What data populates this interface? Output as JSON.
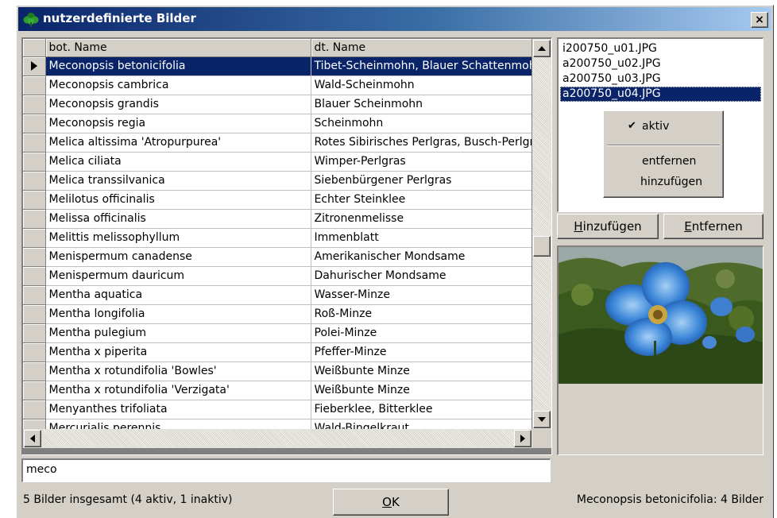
{
  "window": {
    "title": "nutzerdefinierte Bilder",
    "close_label": "×"
  },
  "grid": {
    "columns": [
      "bot. Name",
      "dt. Name"
    ],
    "selected_index": 0,
    "rows": [
      {
        "bot": "Meconopsis betonicifolia",
        "dt": "Tibet-Scheinmohn, Blauer Schattenmohn"
      },
      {
        "bot": "Meconopsis cambrica",
        "dt": "Wald-Scheinmohn"
      },
      {
        "bot": "Meconopsis grandis",
        "dt": "Blauer Scheinmohn"
      },
      {
        "bot": "Meconopsis regia",
        "dt": "Scheinmohn"
      },
      {
        "bot": "Melica altissima 'Atropurpurea'",
        "dt": "Rotes Sibirisches Perlgras, Busch-Perlgras"
      },
      {
        "bot": "Melica ciliata",
        "dt": "Wimper-Perlgras"
      },
      {
        "bot": "Melica transsilvanica",
        "dt": "Siebenbürgener Perlgras"
      },
      {
        "bot": "Melilotus officinalis",
        "dt": "Echter Steinklee"
      },
      {
        "bot": "Melissa officinalis",
        "dt": "Zitronenmelisse"
      },
      {
        "bot": "Melittis melissophyllum",
        "dt": "Immenblatt"
      },
      {
        "bot": "Menispermum canadense",
        "dt": "Amerikanischer Mondsame"
      },
      {
        "bot": "Menispermum dauricum",
        "dt": "Dahurischer Mondsame"
      },
      {
        "bot": "Mentha aquatica",
        "dt": "Wasser-Minze"
      },
      {
        "bot": "Mentha longifolia",
        "dt": "Roß-Minze"
      },
      {
        "bot": "Mentha pulegium",
        "dt": "Polei-Minze"
      },
      {
        "bot": "Mentha x piperita",
        "dt": "Pfeffer-Minze"
      },
      {
        "bot": "Mentha x rotundifolia 'Bowles'",
        "dt": "Weißbunte Minze"
      },
      {
        "bot": "Mentha x rotundifolia 'Verzigata'",
        "dt": "Weißbunte Minze"
      },
      {
        "bot": "Menyanthes trifoliata",
        "dt": "Fieberklee, Bitterklee"
      },
      {
        "bot": "Mercurialis perennis",
        "dt": "Wald-Bingelkraut"
      }
    ]
  },
  "files": {
    "items": [
      "i200750_u01.JPG",
      "a200750_u02.JPG",
      "a200750_u03.JPG",
      "a200750_u04.JPG"
    ],
    "selected_index": 3
  },
  "context_menu": {
    "aktiv": "aktiv",
    "entfernen": "entfernen",
    "hinzufuegen": "hinzufügen"
  },
  "buttons": {
    "add_accel": "H",
    "add_rest": "inzufügen",
    "remove_accel": "E",
    "remove_rest": "ntfernen",
    "ok_accel": "O",
    "ok_rest": "K"
  },
  "filter": {
    "value": "meco"
  },
  "status": {
    "summary": "5 Bilder insgesamt (4 aktiv, 1 inaktiv)",
    "selection": "Meconopsis betonicifolia: 4 Bilder"
  },
  "colors": {
    "selection": "#0a246a",
    "face": "#d4d0c8"
  }
}
